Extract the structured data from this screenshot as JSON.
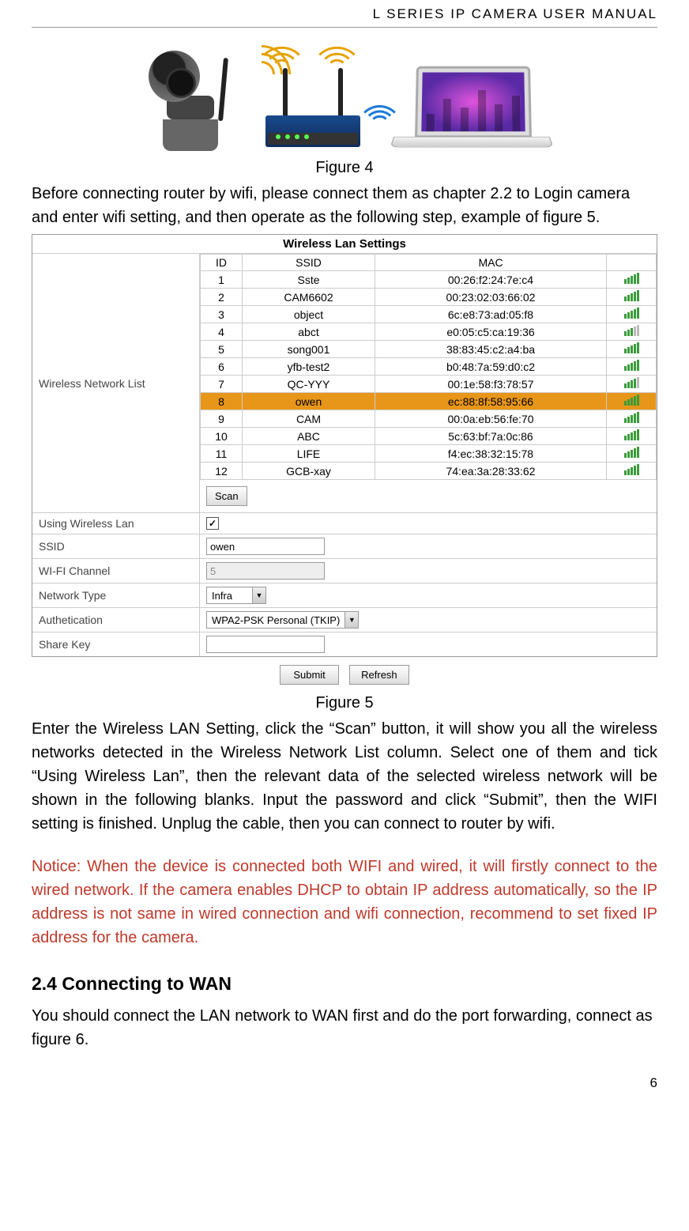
{
  "header": "L  SERIES  IP  CAMERA  USER  MANUAL",
  "figure4_caption": "Figure 4",
  "intro_para": "Before connecting router by wifi, please connect them as chapter 2.2 to Login camera and enter wifi setting, and then operate as the following step, example of figure 5.",
  "settings": {
    "title": "Wireless Lan Settings",
    "list_label": "Wireless Network List",
    "columns": {
      "id": "ID",
      "ssid": "SSID",
      "mac": "MAC"
    },
    "networks": [
      {
        "id": "1",
        "ssid": "Sste",
        "mac": "00:26:f2:24:7e:c4",
        "bars": 5
      },
      {
        "id": "2",
        "ssid": "CAM6602",
        "mac": "00:23:02:03:66:02",
        "bars": 5
      },
      {
        "id": "3",
        "ssid": "object",
        "mac": "6c:e8:73:ad:05:f8",
        "bars": 5
      },
      {
        "id": "4",
        "ssid": "abct",
        "mac": "e0:05:c5:ca:19:36",
        "bars": 3
      },
      {
        "id": "5",
        "ssid": "song001",
        "mac": "38:83:45:c2:a4:ba",
        "bars": 5
      },
      {
        "id": "6",
        "ssid": "yfb-test2",
        "mac": "b0:48:7a:59:d0:c2",
        "bars": 5
      },
      {
        "id": "7",
        "ssid": "QC-YYY",
        "mac": "00:1e:58:f3:78:57",
        "bars": 4
      },
      {
        "id": "8",
        "ssid": "owen",
        "mac": "ec:88:8f:58:95:66",
        "bars": 5,
        "selected": true
      },
      {
        "id": "9",
        "ssid": "CAM",
        "mac": "00:0a:eb:56:fe:70",
        "bars": 5
      },
      {
        "id": "10",
        "ssid": "ABC",
        "mac": "5c:63:bf:7a:0c:86",
        "bars": 5
      },
      {
        "id": "11",
        "ssid": "LIFE",
        "mac": "f4:ec:38:32:15:78",
        "bars": 5
      },
      {
        "id": "12",
        "ssid": "GCB-xay",
        "mac": "74:ea:3a:28:33:62",
        "bars": 5
      }
    ],
    "scan_button": "Scan",
    "fields": {
      "using_label": "Using Wireless Lan",
      "using_checked": true,
      "ssid_label": "SSID",
      "ssid_value": "owen",
      "channel_label": "WI-FI Channel",
      "channel_value": "5",
      "type_label": "Network Type",
      "type_value": "Infra",
      "auth_label": "Authetication",
      "auth_value": "WPA2-PSK Personal (TKIP)",
      "key_label": "Share Key",
      "key_value": ""
    },
    "submit": "Submit",
    "refresh": "Refresh"
  },
  "figure5_caption": "Figure 5",
  "main_para": "Enter the Wireless LAN Setting, click the “Scan” button, it will show you all the wireless networks detected in the Wireless Network List column. Select one of them and tick “Using Wireless Lan”, then the relevant data of the selected wireless network will be shown in the following blanks. Input the password and click “Submit”, then the WIFI setting is finished. Unplug the cable, then you can connect to router by wifi.",
  "notice": "Notice: When the device is connected both WIFI and wired, it will firstly connect to the wired network. If the camera enables DHCP to obtain IP address automatically, so the IP address is not same in wired connection and wifi connection, recommend to set fixed IP address for the camera.",
  "section_heading": "2.4 Connecting to WAN",
  "wan_para": "You should connect the LAN network to WAN first and do the port forwarding, connect as figure 6.",
  "page_number": "6"
}
